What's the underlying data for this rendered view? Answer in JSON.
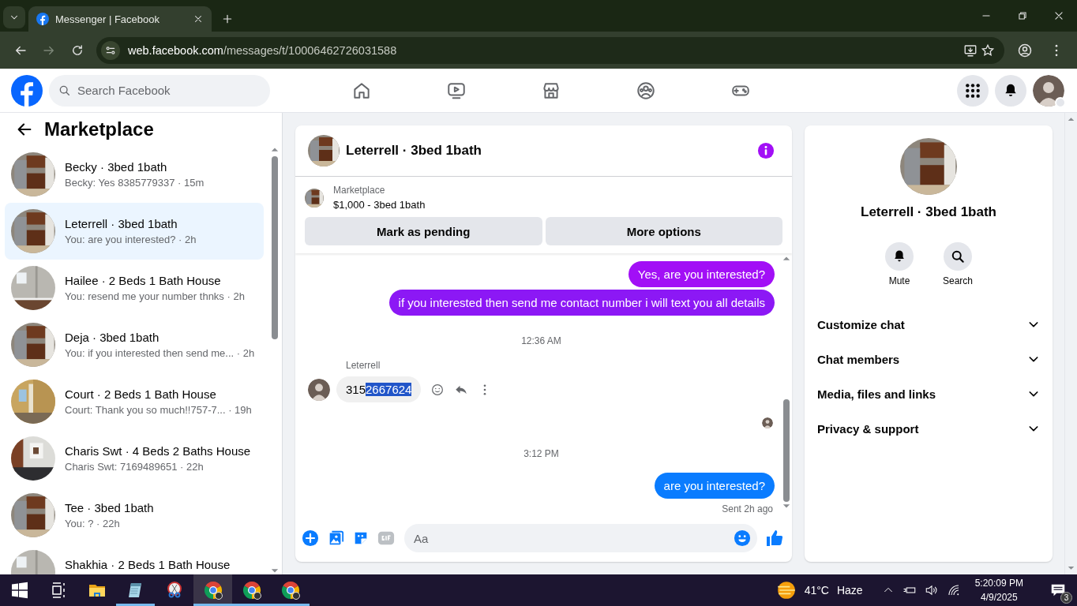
{
  "browser": {
    "tab_title": "Messenger | Facebook",
    "url_host": "web.facebook.com",
    "url_path": "/messages/t/10006462726031588"
  },
  "top_nav": {
    "search_placeholder": "Search Facebook",
    "items": [
      {
        "kind": "home",
        "selected": false
      },
      {
        "kind": "video",
        "selected": false
      },
      {
        "kind": "marketplace",
        "selected": false
      },
      {
        "kind": "groups",
        "selected": false
      },
      {
        "kind": "gaming",
        "selected": false
      }
    ]
  },
  "sidebar": {
    "title": "Marketplace",
    "conversations": [
      {
        "name": "Becky · 3bed 1bath",
        "preview": "Becky: Yes 8385779337 · 15m",
        "selected": false
      },
      {
        "name": "Leterrell · 3bed 1bath",
        "preview": "You: are you interested? · 2h",
        "selected": true
      },
      {
        "name": "Hailee · 2 Beds 1 Bath House",
        "preview": "You: resend me your number thnks · 2h",
        "selected": false
      },
      {
        "name": "Deja · 3bed 1bath",
        "preview": "You: if you interested then send me... · 2h",
        "selected": false
      },
      {
        "name": "Court · 2 Beds 1 Bath House",
        "preview": "Court: Thank you so much!!757-7...  · 19h",
        "selected": false
      },
      {
        "name": "Charis Swt · 4 Beds 2 Baths House",
        "preview": "Charis Swt: 7169489651 · 22h",
        "selected": false
      },
      {
        "name": "Tee · 3bed 1bath",
        "preview": "You: ? · 22h",
        "selected": false
      },
      {
        "name": "Shakhia · 2 Beds 1 Bath House",
        "selected": false
      }
    ]
  },
  "chat": {
    "title": "Leterrell · 3bed 1bath",
    "listing": {
      "label": "Marketplace",
      "summary": "$1,000 - 3bed 1bath"
    },
    "buttons": [
      "Mark as pending",
      "More options"
    ],
    "messages": [
      {
        "kind": "outgoing",
        "text": "Yes, are you interested?",
        "color": "#a20ff6"
      },
      {
        "kind": "outgoing",
        "text": "if you interested then send me contact number i will text you all details",
        "color": "#8c18f5"
      },
      {
        "kind": "timestamp",
        "text": "12:36 AM"
      },
      {
        "kind": "incoming",
        "sender": "Leterrell",
        "text": "315",
        "highlighted": "2667624"
      },
      {
        "kind": "seen"
      },
      {
        "kind": "timestamp",
        "text": "3:12 PM"
      },
      {
        "kind": "outgoing",
        "text": "are you interested?",
        "color": "#0a7cff",
        "status": "Sent 2h ago"
      }
    ],
    "composer": {
      "placeholder": "Aa"
    }
  },
  "info": {
    "name": "Leterrell · 3bed 1bath",
    "actions": [
      {
        "kind": "mute",
        "label": "Mute"
      },
      {
        "kind": "search",
        "label": "Search"
      }
    ],
    "sections": [
      {
        "label": "Customize chat",
        "expanded": false
      },
      {
        "label": "Chat members",
        "expanded": false
      },
      {
        "label": "Media, files and links",
        "expanded": false
      },
      {
        "label": "Privacy & support",
        "expanded": false
      }
    ]
  },
  "taskbar": {
    "apps": [
      {
        "kind": "start",
        "running": false,
        "selected": false
      },
      {
        "kind": "task-view",
        "running": false,
        "selected": false
      },
      {
        "kind": "explorer",
        "running": false,
        "selected": false
      },
      {
        "kind": "notepad",
        "running": true,
        "selected": false
      },
      {
        "kind": "snipping",
        "running": false,
        "selected": false
      },
      {
        "kind": "chrome",
        "running": true,
        "selected": true
      },
      {
        "kind": "chrome",
        "running": true,
        "selected": false
      },
      {
        "kind": "chrome",
        "running": true,
        "selected": false
      }
    ],
    "weather": {
      "temperature": "41°C",
      "condition": "Haze"
    },
    "time": "5:20:09 PM",
    "date": "4/9/2025",
    "notifications": "3"
  }
}
